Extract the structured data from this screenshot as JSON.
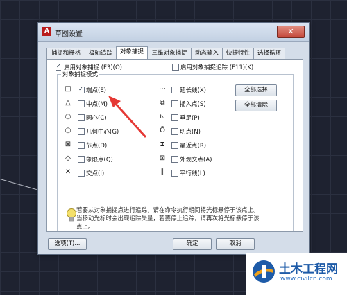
{
  "dialog": {
    "title": "草图设置",
    "close": "✕"
  },
  "tabs": [
    {
      "label": "捕捉和栅格"
    },
    {
      "label": "极轴追踪"
    },
    {
      "label": "对象捕捉",
      "active": true
    },
    {
      "label": "三维对象捕捉"
    },
    {
      "label": "动态输入"
    },
    {
      "label": "快捷特性"
    },
    {
      "label": "选择循环"
    }
  ],
  "options": {
    "enable_osnap": {
      "label": "启用对象捕捉 (F3)(O)",
      "checked": true
    },
    "enable_tracking": {
      "label": "启用对象捕捉追踪 (F11)(K)",
      "checked": false
    }
  },
  "group_title": "对象捕捉模式",
  "snap_modes": [
    {
      "symbol": "□",
      "label": "端点(E)",
      "checked": true
    },
    {
      "symbol": "△",
      "label": "中点(M)",
      "checked": false
    },
    {
      "symbol": "○",
      "label": "圆心(C)",
      "checked": false
    },
    {
      "symbol": "○",
      "label": "几何中心(G)",
      "checked": false
    },
    {
      "symbol": "⊠",
      "label": "节点(D)",
      "checked": false
    },
    {
      "symbol": "◇",
      "label": "象限点(Q)",
      "checked": false
    },
    {
      "symbol": "✕",
      "label": "交点(I)",
      "checked": false
    },
    {
      "symbol": "⋯",
      "label": "延长线(X)",
      "checked": false
    },
    {
      "symbol": "⧉",
      "label": "插入点(S)",
      "checked": false
    },
    {
      "symbol": "⊾",
      "label": "垂足(P)",
      "checked": false
    },
    {
      "symbol": "Ō",
      "label": "切点(N)",
      "checked": false
    },
    {
      "symbol": "⧗",
      "label": "最近点(R)",
      "checked": false
    },
    {
      "symbol": "⊠",
      "label": "外观交点(A)",
      "checked": false
    },
    {
      "symbol": "∥",
      "label": "平行线(L)",
      "checked": false
    }
  ],
  "buttons": {
    "select_all": "全部选择",
    "clear_all": "全部清除",
    "options": "选项(T)...",
    "ok": "确定",
    "cancel": "取消"
  },
  "info_text": "若要从对象捕捉点进行追踪，请在命令执行期间将光标悬停于该点上。当移动光标时会出现追踪矢量，若要停止追踪，请再次将光标悬停于该点上。",
  "watermark": {
    "name": "土木工程网",
    "url": "www.civilcn.com",
    "colors": {
      "primary": "#1e5ba8",
      "accent": "#f0a21a"
    }
  }
}
